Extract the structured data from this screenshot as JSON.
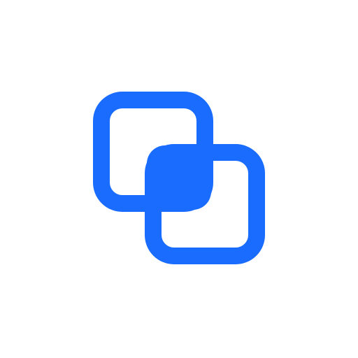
{
  "icon": {
    "name": "intersect-squares-icon",
    "semantic": "intersect",
    "color": "#1a6cff",
    "background": "#ffffff"
  }
}
